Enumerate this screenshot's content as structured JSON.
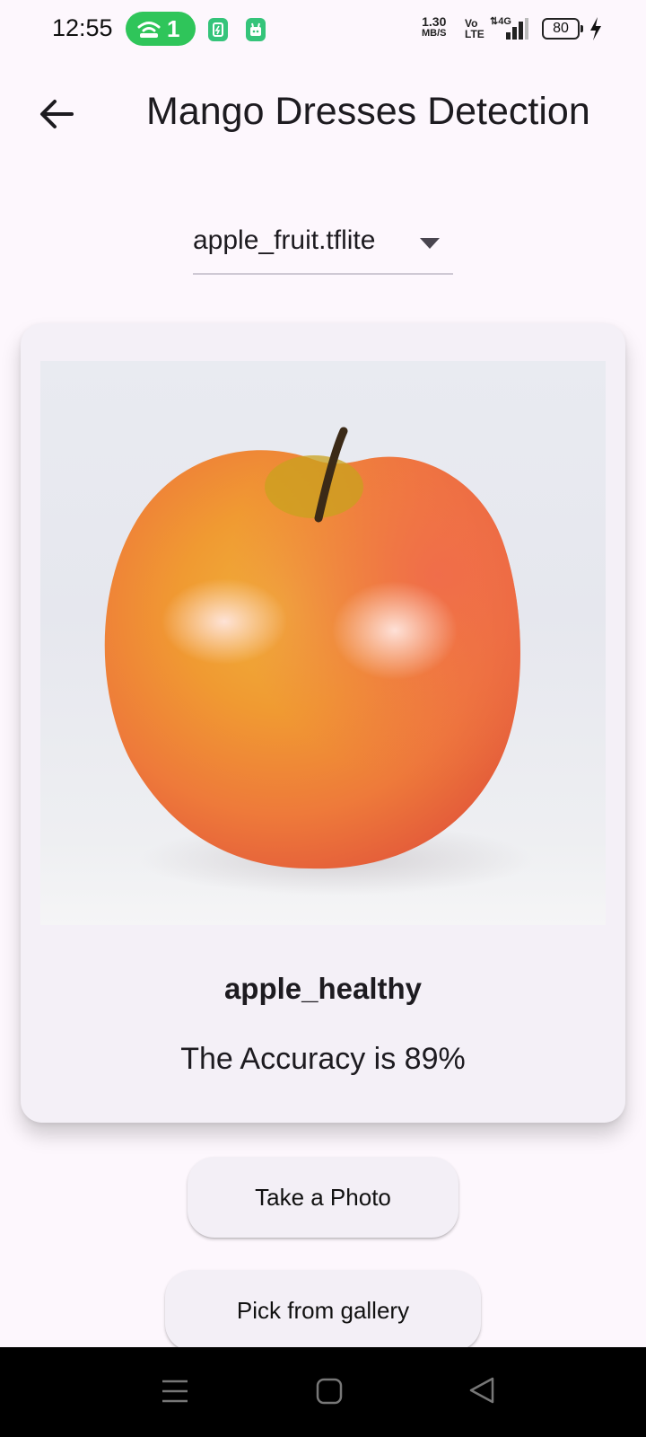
{
  "status_bar": {
    "time": "12:55",
    "hotspot_count": "1",
    "speed_value": "1.30",
    "speed_unit": "MB/S",
    "volte": "Vo LTE",
    "network": "4G",
    "battery": "80"
  },
  "app_bar": {
    "title": "Mango Dresses Detection"
  },
  "model_dropdown": {
    "selected": "apple_fruit.tflite"
  },
  "result": {
    "label": "apple_healthy",
    "accuracy_text": "The Accuracy is 89%"
  },
  "actions": {
    "take_photo": "Take a Photo",
    "pick_gallery": "Pick from gallery"
  },
  "colors": {
    "background": "#fdf7fd",
    "card": "#f4f0f7",
    "pill": "#2fc55a"
  }
}
